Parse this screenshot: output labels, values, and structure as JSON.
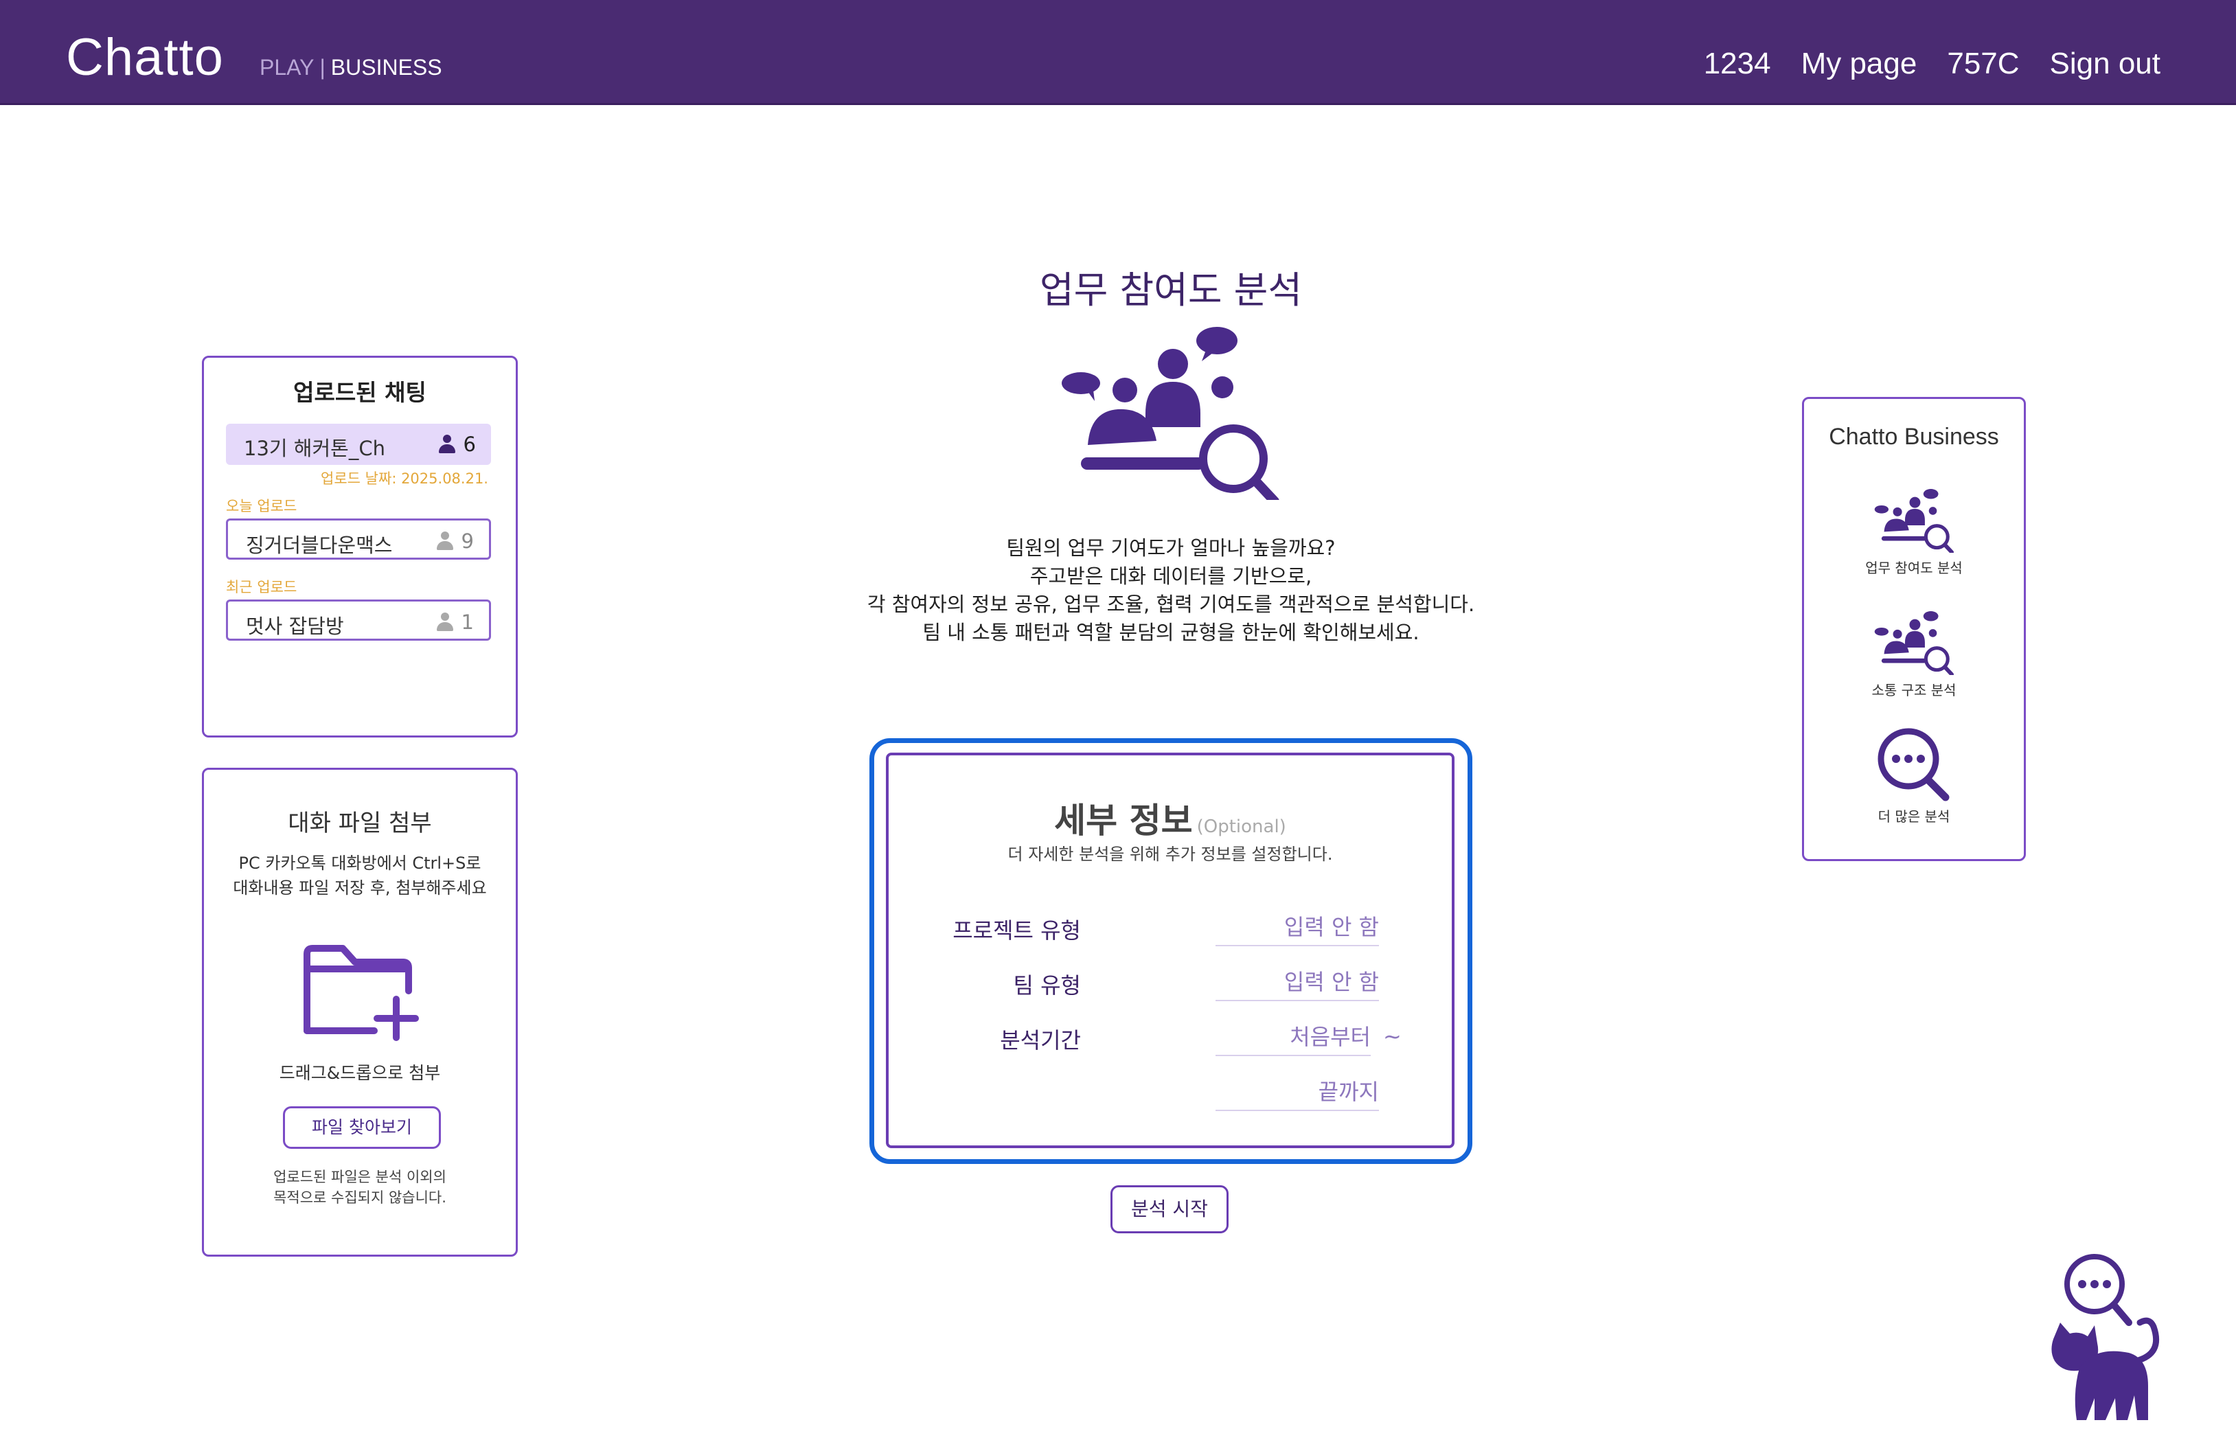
{
  "header": {
    "logo": "Chatto",
    "logo_play": "PLAY",
    "logo_separator": "|",
    "logo_business": "BUSINESS",
    "nav": [
      "1234",
      "My page",
      "757C",
      "Sign out"
    ]
  },
  "uploaded_chats": {
    "title": "업로드된 채팅",
    "active": {
      "name": "13기 해커톤_Ch",
      "count": "6",
      "upload_date": "업로드 날짜: 2025.08.21."
    },
    "today_label": "오늘 업로드",
    "today": {
      "name": "징거더블다운맥스",
      "count": "9"
    },
    "recent_label": "최근 업로드",
    "recent": {
      "name": "멋사 잡담방",
      "count": "1"
    }
  },
  "attach": {
    "title": "대화 파일 첨부",
    "desc_line1": "PC 카카오톡 대화방에서 Ctrl+S로",
    "desc_line2": "대화내용 파일 저장 후, 첨부해주세요",
    "drag_text": "드래그&드롭으로 첨부",
    "browse_label": "파일 찾아보기",
    "note_line1": "업로드된 파일은 분석 이외의",
    "note_line2": "목적으로 수집되지 않습니다."
  },
  "main": {
    "title": "업무 참여도 분석",
    "intro": [
      "팀원의 업무 기여도가 얼마나 높을까요?",
      "주고받은 대화 데이터를 기반으로,",
      "각 참여자의 정보 공유, 업무 조율, 협력 기여도를 객관적으로 분석합니다.",
      "팀 내 소통 패턴과 역할 분담의 균형을 한눈에 확인해보세요."
    ]
  },
  "details": {
    "title": "세부 정보",
    "optional": "(Optional)",
    "subtitle": "더 자세한 분석을 위해 추가 정보를 설정합니다.",
    "project_type_label": "프로젝트 유형",
    "project_type_value": "입력 안 함",
    "team_type_label": "팀 유형",
    "team_type_value": "입력 안 함",
    "period_label": "분석기간",
    "period_start": "처음부터",
    "period_tilde": "~",
    "period_end": "끝까지",
    "start_button": "분석 시작"
  },
  "business_panel": {
    "title": "Chatto Business",
    "items": [
      {
        "label": "업무 참여도 분석",
        "icon": "team-analysis-icon"
      },
      {
        "label": "소통 구조 분석",
        "icon": "team-analysis-icon"
      },
      {
        "label": "더 많은 분석",
        "icon": "more-search-icon"
      }
    ]
  },
  "colors": {
    "header_bg": "#4a2b72",
    "accent_purple": "#6a3db3",
    "focus_blue": "#1565d8",
    "upload_date_orange": "#e3a73a",
    "active_chat_bg": "#e5d9fa"
  },
  "icons": {
    "person": "person-icon",
    "folder_add": "folder-add-icon",
    "hero": "team-analysis-icon",
    "mascot": "cat-search-mascot-icon"
  }
}
